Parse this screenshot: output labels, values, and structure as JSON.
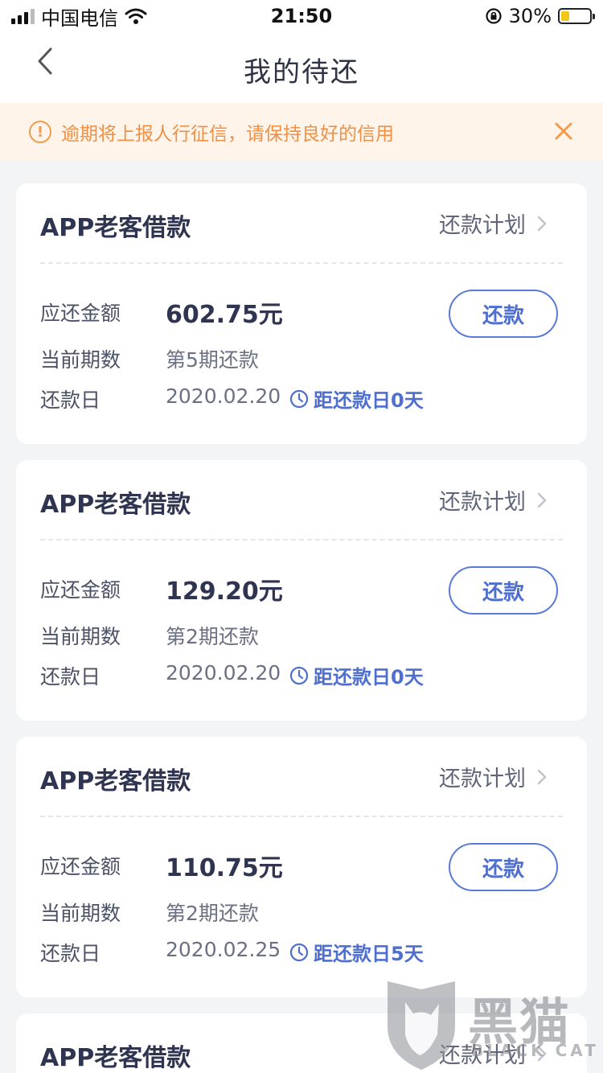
{
  "status_bar": {
    "carrier": "中国电信",
    "time": "21:50",
    "battery_percent": "30%",
    "battery_level": 0.3
  },
  "nav": {
    "title": "我的待还",
    "back_icon": "chevron-left-icon"
  },
  "notice": {
    "text": "逾期将上报人行征信，请保持良好的信用",
    "icon": "alert-circle-icon",
    "close_icon": "close-icon",
    "color": "#ef9045"
  },
  "labels": {
    "amount": "应还金额",
    "period": "当前期数",
    "due_date": "还款日",
    "plan": "还款计划",
    "pay": "还款"
  },
  "cards": [
    {
      "title": "APP老客借款",
      "amount": "602.75元",
      "period": "第5期还款",
      "due_date": "2020.02.20",
      "countdown": "距还款日0天"
    },
    {
      "title": "APP老客借款",
      "amount": "129.20元",
      "period": "第2期还款",
      "due_date": "2020.02.20",
      "countdown": "距还款日0天"
    },
    {
      "title": "APP老客借款",
      "amount": "110.75元",
      "period": "第2期还款",
      "due_date": "2020.02.25",
      "countdown": "距还款日5天"
    },
    {
      "title": "APP老客借款"
    }
  ],
  "watermark": {
    "text": "黑猫",
    "sub": "BLACK CAT"
  },
  "colors": {
    "accent": "#4f6fd0",
    "notice_bg": "#fef4ea",
    "page_bg": "#f3f4f6"
  }
}
